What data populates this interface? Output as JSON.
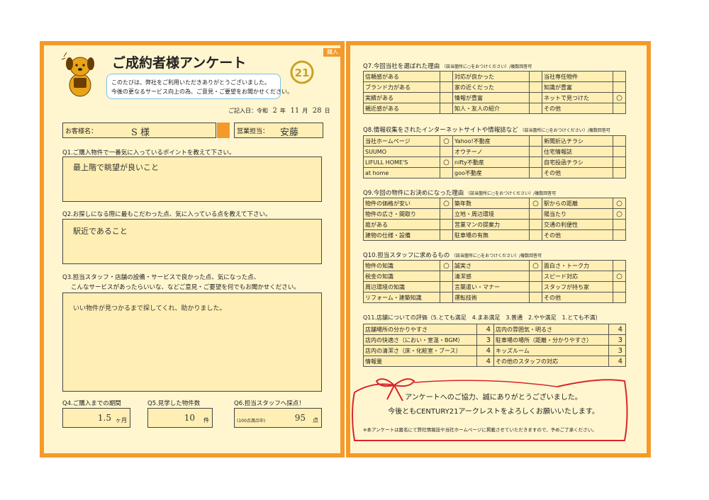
{
  "left": {
    "tag": "購入",
    "title": "ご成約者様アンケート",
    "intro1": "このたびは、弊社をご利用いただきありがとうございました。",
    "intro2": "今後の更なるサービス向上の為、ご意見・ご要望をお聞かせください。",
    "date_prefix": "ご記入日：令和",
    "date_year": "2",
    "date_year_unit": "年",
    "date_month": "11",
    "date_month_unit": "月",
    "date_day": "28",
    "date_day_unit": "日",
    "customer_label": "お客様名：",
    "customer_value": "S 様",
    "staff_label": "営業担当：",
    "staff_value": "安藤",
    "q1": "Q1.ご購入物件で一番気に入っているポイントを教えて下さい。",
    "a1": "最上階で眺望が良いこと",
    "q2": "Q2.お探しになる際に最もこだわった点、気に入っている点を教えて下さい。",
    "a2": "駅近であること",
    "q3_line1": "Q3.担当スタッフ・店舗の設備・サービスで良かった点、気になった点、",
    "q3_line2": "こんなサービスがあったらいいな、などご意見・ご要望を何でもお聞かせください。",
    "a3": "いい物件が見つかるまで探してくれ、助かりました。",
    "q4": "Q4.ご購入までの期間",
    "a4_value": "1.5",
    "a4_unit": "ヶ月",
    "q5": "Q5.見学した物件数",
    "a5_value": "10",
    "a5_unit": "件",
    "q6": "Q6.担当スタッフへ採点！",
    "a6_note": "(100点満点中)",
    "a6_value": "95",
    "a6_unit": "点"
  },
  "right": {
    "q7": "Q7.今回当社を選ばれた理由",
    "q7_note": "（該当箇所に○をおつけください）/複数回答可",
    "q7_rows": [
      [
        "信頼感がある",
        "",
        "対応が良かった",
        "",
        "当社専任物件",
        ""
      ],
      [
        "ブランド力がある",
        "",
        "家の近くだった",
        "",
        "知識が豊富",
        ""
      ],
      [
        "実績がある",
        "",
        "情報が豊富",
        "",
        "ネットで見つけた",
        "○"
      ],
      [
        "親近感がある",
        "",
        "知人・友人の紹介",
        "",
        "その他",
        ""
      ]
    ],
    "q8": "Q8.情報収集をされたインターネットサイトや情報誌など",
    "q8_note": "（該当箇所に○をおつけください）/複数回答可",
    "q8_rows": [
      [
        "当社ホームページ",
        "○",
        "Yahoo!不動産",
        "",
        "新聞折込チラシ",
        ""
      ],
      [
        "SUUMO",
        "",
        "オウチーノ",
        "",
        "住宅情報誌",
        ""
      ],
      [
        "LIFULL HOME'S",
        "○",
        "nifty不動産",
        "",
        "自宅投函チラシ",
        ""
      ],
      [
        "at home",
        "",
        "goo不動産",
        "",
        "その他",
        ""
      ]
    ],
    "q9": "Q9.今回の物件にお決めになった理由",
    "q9_note": "（該当箇所に○をおつけください）/複数回答可",
    "q9_rows": [
      [
        "物件の価格が安い",
        "○",
        "築年数",
        "○",
        "駅からの距離",
        "○"
      ],
      [
        "物件の広さ・間取り",
        "",
        "立地・周辺環境",
        "",
        "陽当たり",
        "○"
      ],
      [
        "庭がある",
        "",
        "営業マンの提案力",
        "",
        "交通の利便性",
        ""
      ],
      [
        "建物の仕様・設備",
        "",
        "駐車場の有無",
        "",
        "その他",
        ""
      ]
    ],
    "q10": "Q10.担当スタッフに求めるもの",
    "q10_note": "（該当箇所に○をおつけください）/複数回答可",
    "q10_rows": [
      [
        "物件の知識",
        "○",
        "誠実さ",
        "○",
        "面白さ・トーク力",
        ""
      ],
      [
        "税金の知識",
        "",
        "清潔感",
        "",
        "スピード対応",
        "○"
      ],
      [
        "周辺環境の知識",
        "",
        "言葉遣い・マナー",
        "",
        "スタッフが持ち家",
        ""
      ],
      [
        "リフォーム・建築知識",
        "",
        "運転技術",
        "",
        "その他",
        ""
      ]
    ],
    "q11": "Q11.店舗についての評価（5.とても満足　4.まあ満足　3.普通　2.やや満足　1.とても不満）",
    "q11_rows": [
      [
        "店舗場所の分かりやすさ",
        "4",
        "店内の雰囲気・明るさ",
        "4"
      ],
      [
        "店内の快適さ（におい・室温・BGM）",
        "3",
        "駐車場の場所（距離・分かりやすさ）",
        "3"
      ],
      [
        "店内の清潔さ（床・化粧室・ブース）",
        "4",
        "キッズルーム",
        "3"
      ],
      [
        "情報量",
        "4",
        "その他のスタッフの対応",
        "4"
      ]
    ],
    "thanks1": "アンケートへのご協力、誠にありがとうございました。",
    "thanks2": "今後ともCENTURY21アークレストをよろしくお願いいたします。",
    "footnote": "※本アンケートは匿名にて弊社情報誌や当社ホームページに掲載させていただきますので、予めご了承ください。"
  },
  "colors": {
    "frame": "#f49a2a",
    "paper": "#fff6cf",
    "field": "#ffefb5",
    "ribbon": "#d9252c",
    "accent": "#e8a317"
  },
  "icons": {
    "mascot": "dog-mascot-icon",
    "logo": "century21-logo-icon"
  }
}
